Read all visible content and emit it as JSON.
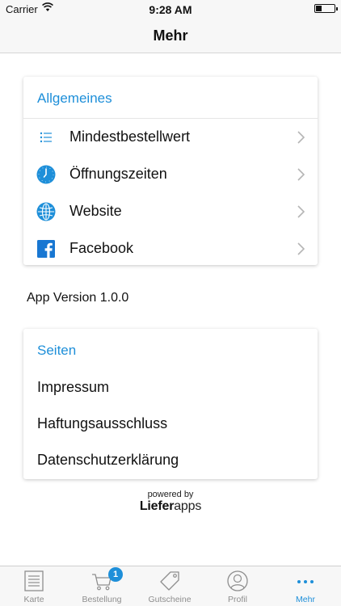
{
  "status_bar": {
    "carrier": "Carrier",
    "time": "9:28 AM"
  },
  "nav": {
    "title": "Mehr"
  },
  "general_section": {
    "header": "Allgemeines",
    "items": [
      {
        "label": "Mindestbestellwert",
        "icon": "list-icon"
      },
      {
        "label": "Öffnungszeiten",
        "icon": "clock-icon"
      },
      {
        "label": "Website",
        "icon": "globe-icon"
      },
      {
        "label": "Facebook",
        "icon": "facebook-icon"
      }
    ]
  },
  "app_version": "App Version 1.0.0",
  "pages_section": {
    "header": "Seiten",
    "items": [
      {
        "label": "Impressum"
      },
      {
        "label": "Haftungsausschluss"
      },
      {
        "label": "Datenschutzerklärung"
      }
    ]
  },
  "footer": {
    "powered_by": "powered by",
    "brand_bold": "Liefer",
    "brand_light": "apps"
  },
  "tab_bar": {
    "tabs": [
      {
        "label": "Karte",
        "icon": "menu-card-icon"
      },
      {
        "label": "Bestellung",
        "icon": "cart-icon",
        "badge": "1"
      },
      {
        "label": "Gutscheine",
        "icon": "tag-icon"
      },
      {
        "label": "Profil",
        "icon": "profile-icon"
      },
      {
        "label": "Mehr",
        "icon": "more-dots-icon",
        "active": true
      }
    ]
  },
  "colors": {
    "accent": "#1e8fd9",
    "inactive_tab": "#8e8e8e",
    "facebook": "#1877d2"
  }
}
